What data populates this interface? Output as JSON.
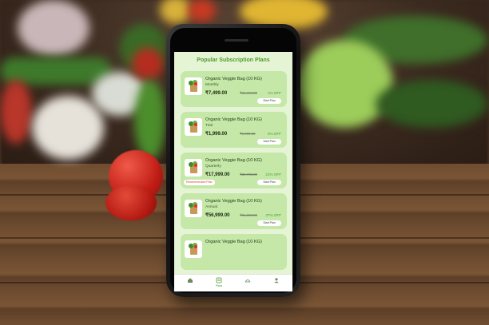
{
  "screen_title": "Popular Subscription Plans",
  "plans": [
    {
      "name": "Organic Veggie Bag (10 KG)",
      "period": "Monthly",
      "price": "₹7,499.00",
      "old_price": "₹10,998.00",
      "discount": "1% OFF",
      "button": "Start Plan",
      "badge": ""
    },
    {
      "name": "Organic Veggie Bag (10 KG)",
      "period": "Trial",
      "price": "₹1,999.00",
      "old_price": "₹1,999.00",
      "discount": "0% OFF",
      "button": "Start Plan",
      "badge": ""
    },
    {
      "name": "Organic Veggie Bag (10 KG)",
      "period": "Quarterly",
      "price": "₹17,999.00",
      "old_price": "₹22,788.00",
      "discount": "21% OFF",
      "button": "Start Plan",
      "badge": "Recommended Plan"
    },
    {
      "name": "Organic Veggie Bag (10 KG)",
      "period": "Annual",
      "price": "₹56,999.00",
      "old_price": "₹91,032.00",
      "discount": "37% OFF",
      "button": "Start Plan",
      "badge": ""
    },
    {
      "name": "Organic Veggie Bag (10 KG)",
      "period": "",
      "price": "",
      "old_price": "",
      "discount": "",
      "button": "",
      "badge": ""
    }
  ],
  "tabbar": {
    "tabs": [
      {
        "icon": "home-icon",
        "label": ""
      },
      {
        "icon": "plans-icon",
        "label": "Plans"
      },
      {
        "icon": "orders-icon",
        "label": ""
      },
      {
        "icon": "profile-icon",
        "label": ""
      }
    ]
  },
  "colors": {
    "accent": "#4f9a2c",
    "card": "#c5e8a9",
    "screen_bg": "#e6f4d6",
    "badge_text": "#d23a3a"
  }
}
